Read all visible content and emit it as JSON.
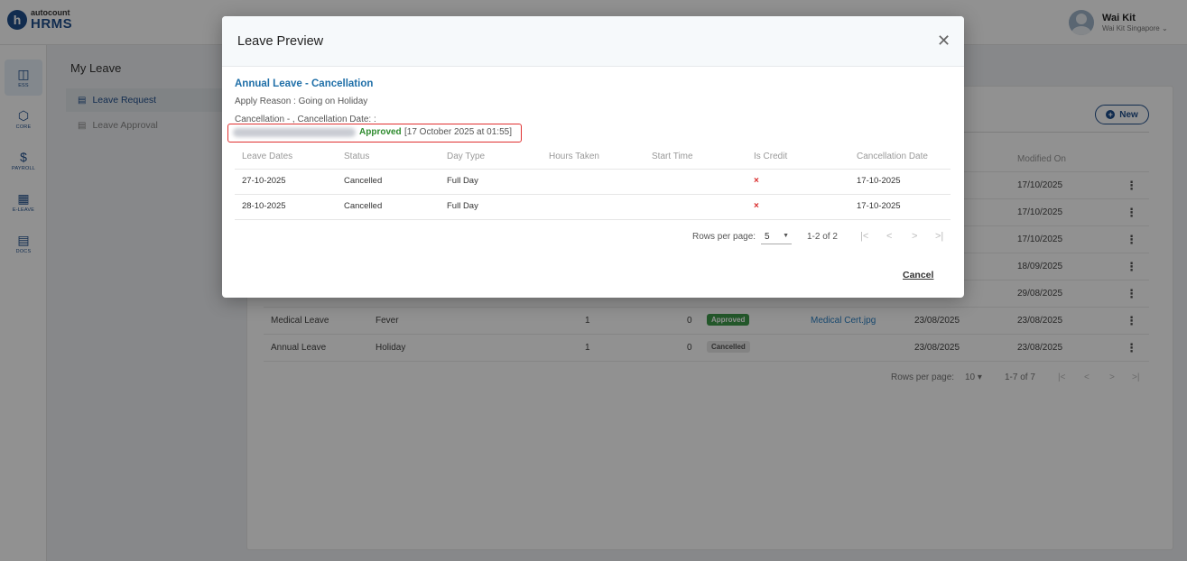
{
  "app": {
    "logo_small": "autocount",
    "logo_big": "HRMS",
    "logo_letter": "h"
  },
  "user": {
    "name": "Wai Kit",
    "company": "Wai Kit Singapore ⌄"
  },
  "rail": [
    {
      "icon": "◫",
      "label": "ESS"
    },
    {
      "icon": "⬡",
      "label": "CORE"
    },
    {
      "icon": "$",
      "label": "PAYROLL"
    },
    {
      "icon": "▦",
      "label": "E-LEAVE"
    },
    {
      "icon": "▤",
      "label": "DOCS"
    }
  ],
  "subnav": {
    "title": "My Leave",
    "items": [
      {
        "label": "Leave Request"
      },
      {
        "label": "Leave Approval"
      }
    ]
  },
  "main": {
    "new_label": "New",
    "modified_header": "Modified On",
    "modified_dates": [
      "17/10/2025",
      "17/10/2025",
      "17/10/2025",
      "18/09/2025",
      "29/08/2025"
    ],
    "rows": [
      {
        "type": "Medical Leave",
        "reason": "Fever",
        "days": "1",
        "hours": "0",
        "status": "Approved",
        "attachment": "Medical Cert.jpg",
        "applied": "23/08/2025",
        "modified": "23/08/2025"
      },
      {
        "type": "Annual Leave",
        "reason": "Holiday",
        "days": "1",
        "hours": "0",
        "status": "Cancelled",
        "attachment": "",
        "applied": "23/08/2025",
        "modified": "23/08/2025"
      }
    ],
    "pager": {
      "rows_label": "Rows per page:",
      "rows_value": "10",
      "range": "1-7 of 7"
    }
  },
  "modal": {
    "title": "Leave Preview",
    "heading": "Annual Leave - Cancellation",
    "reason": "Apply Reason : Going on Holiday",
    "cancellation_line": "Cancellation - , Cancellation Date: :",
    "status": "Approved",
    "status_date": "[17 October 2025 at 01:55]",
    "columns": [
      "Leave Dates",
      "Status",
      "Day Type",
      "Hours Taken",
      "Start Time",
      "Is Credit",
      "Cancellation Date"
    ],
    "rows": [
      {
        "date": "27-10-2025",
        "status": "Cancelled",
        "day_type": "Full Day",
        "hours": "",
        "start": "",
        "credit": "×",
        "cancel_date": "17-10-2025"
      },
      {
        "date": "28-10-2025",
        "status": "Cancelled",
        "day_type": "Full Day",
        "hours": "",
        "start": "",
        "credit": "×",
        "cancel_date": "17-10-2025"
      }
    ],
    "pager": {
      "rows_label": "Rows per page:",
      "rows_value": "5",
      "range": "1-2 of 2"
    },
    "cancel_label": "Cancel"
  }
}
